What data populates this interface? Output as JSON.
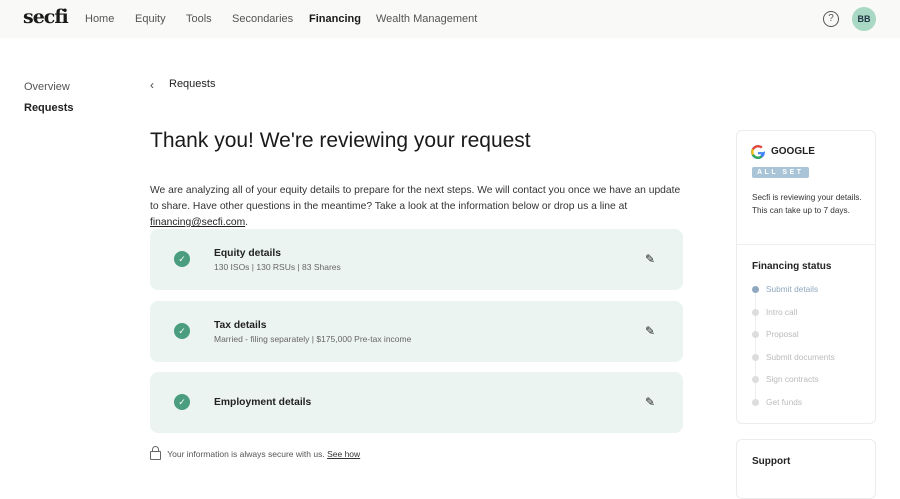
{
  "header": {
    "logo": "secfi",
    "nav": [
      "Home",
      "Equity",
      "Tools",
      "Secondaries",
      "Financing",
      "Wealth Management"
    ],
    "active": "Financing",
    "help": "?",
    "avatar": "BB"
  },
  "sidebar": [
    "Overview",
    "Requests"
  ],
  "breadcrumb": "Requests",
  "title": "Thank you! We're reviewing your request",
  "intro": "We are analyzing all of your equity details to prepare for the next steps. We will contact you once we have an update to share. Have other questions in the meantime? Take a look at the information below or drop us a line at ",
  "email": "financing@secfi.com",
  "cards": [
    {
      "title": "Equity details",
      "subtitle": "130 ISOs | 130 RSUs | 83 Shares"
    },
    {
      "title": "Tax details",
      "subtitle": "Married - filing separately | $175,000 Pre-tax income"
    },
    {
      "title": "Employment details",
      "subtitle": ""
    }
  ],
  "secure": {
    "text": "Your information is always secure with us.",
    "link": "See how"
  },
  "company": {
    "name": "GOOGLE",
    "badge": "ALL SET",
    "desc": "Secfi is reviewing your details. This can take up to 7 days."
  },
  "status": {
    "title": "Financing status",
    "steps": [
      "Submit details",
      "Intro call",
      "Proposal",
      "Submit documents",
      "Sign contracts",
      "Get funds"
    ]
  },
  "support": "Support"
}
